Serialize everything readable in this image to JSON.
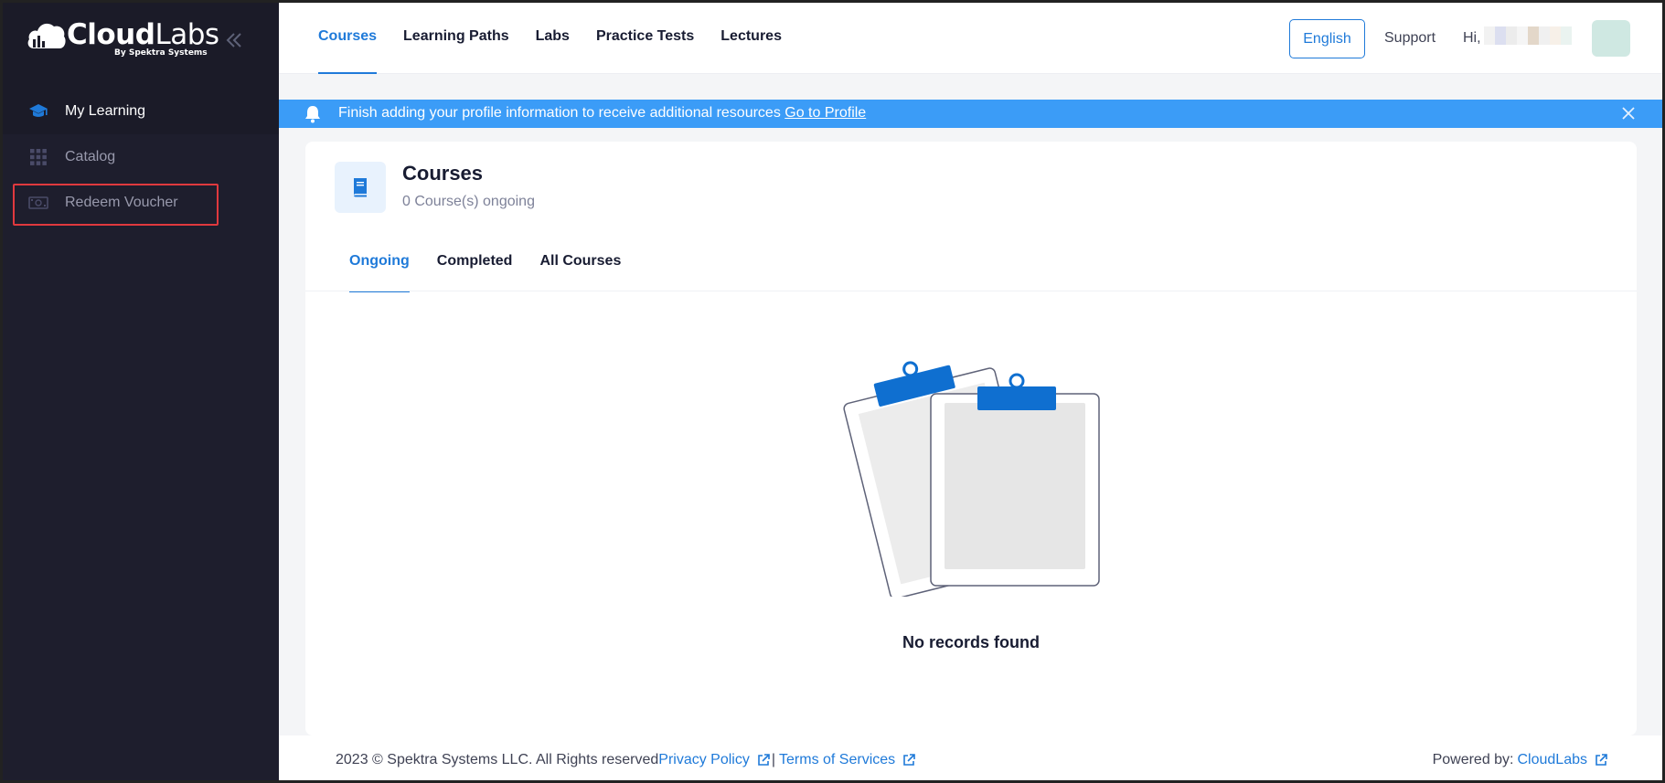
{
  "brand": {
    "name_bold": "Cloud",
    "name_light": "Labs",
    "tagline": "By Spektra Systems"
  },
  "sidebar": {
    "items": [
      {
        "label": "My Learning",
        "icon": "graduation-cap-icon"
      },
      {
        "label": "Catalog",
        "icon": "grid-icon"
      },
      {
        "label": "Redeem Voucher",
        "icon": "banknote-icon"
      }
    ]
  },
  "header": {
    "nav": [
      "Courses",
      "Learning Paths",
      "Labs",
      "Practice Tests",
      "Lectures"
    ],
    "language": "English",
    "support": "Support",
    "greeting": "Hi, I"
  },
  "notice": {
    "text": "Finish adding your profile information to receive additional resources ",
    "link": "Go to Profile"
  },
  "card": {
    "title": "Courses",
    "subtitle": "0 Course(s) ongoing",
    "tabs": [
      "Ongoing",
      "Completed",
      "All Courses"
    ],
    "empty": "No records found"
  },
  "footer": {
    "copyright": "2023 © Spektra Systems LLC. All Rights reserved ",
    "privacy": "Privacy Policy",
    "separator": "|",
    "terms": "Terms of Services",
    "powered_label": "Powered by: ",
    "powered_link": "CloudLabs"
  },
  "colors": {
    "accent": "#1f7ad9",
    "sidebar_bg": "#1e1e2d",
    "notice_bg": "#3b9cf7",
    "highlight": "#e0393e"
  }
}
